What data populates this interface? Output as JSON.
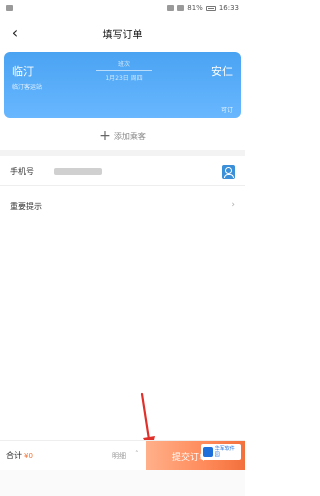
{
  "status_bar": {
    "battery": "81%",
    "time": "16:33"
  },
  "header": {
    "back_icon": "chevron-left-icon",
    "title": "填写订单"
  },
  "route": {
    "from": "临汀",
    "to": "安仁",
    "from_sub": "临汀客运站",
    "center_top": "班次",
    "center_bottom": "1月23日 周四",
    "right_bottom": "可订"
  },
  "passenger": {
    "add_label": "添加乘客",
    "plus_icon": "plus-icon"
  },
  "form": {
    "phone_label": "手机号",
    "phone_value": "",
    "contact_icon": "contact-book-icon",
    "note_label": "重要提示",
    "note_chevron": "chevron-right-icon"
  },
  "bottom_bar": {
    "total_label": "合计",
    "total_price": "¥0",
    "detail_label": "明细",
    "detail_chevron": "chevron-up-icon",
    "submit_label": "提交订单"
  },
  "watermark": {
    "text": "华军软件园"
  },
  "colors": {
    "card_blue": "#4aa3f2",
    "submit_orange": "#ff8a5a",
    "arrow_red": "#e0302b",
    "price_orange": "#f07030"
  }
}
